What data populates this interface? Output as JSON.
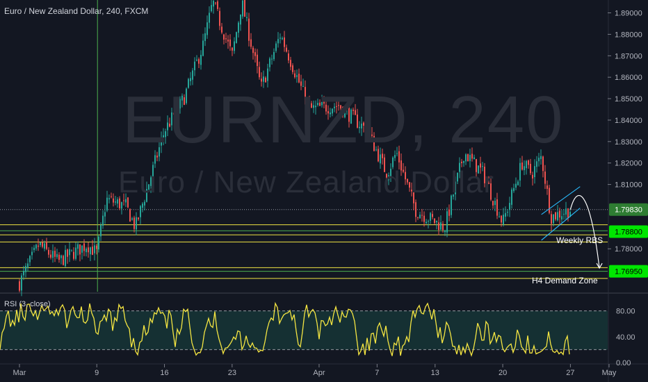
{
  "header": {
    "title": "Euro / New Zealand Dollar, 240, FXCM",
    "rsi_label": "RSI (3, close)"
  },
  "watermark": {
    "symbol": "EURNZD, 240",
    "name": "Euro / New Zealand Dollar"
  },
  "annotations": {
    "weekly_rbs": "Weekly RBS",
    "h4_demand": "H4 Demand Zone"
  },
  "colors": {
    "background": "#131722",
    "up_candle": "#26a69a",
    "down_candle": "#ef5350",
    "support_line": "#f0e442",
    "green_line": "#4caf50",
    "channel": "#29b6f6",
    "rsi_line": "#f5e642",
    "rsi_fill": "#153033",
    "price_tag": "#00e600"
  },
  "chart_data": [
    {
      "type": "candlestick",
      "symbol": "EURNZD",
      "timeframe": "240",
      "source": "FXCM",
      "y_axis": {
        "range": [
          1.76,
          1.896
        ],
        "ticks": [
          "1.89000",
          "1.88000",
          "1.87000",
          "1.86000",
          "1.85000",
          "1.84000",
          "1.83000",
          "1.82000",
          "1.81000",
          "1.78000"
        ]
      },
      "x_axis": {
        "ticks": [
          "Mar",
          "9",
          "16",
          "23",
          "Apr",
          "7",
          "13",
          "20",
          "27",
          "May"
        ]
      },
      "price_tags": [
        {
          "label": "1.79830",
          "value": 1.7983,
          "style": "current"
        },
        {
          "label": "1.78800",
          "value": 1.788,
          "style": "level"
        },
        {
          "label": "1.76950",
          "value": 1.7695,
          "style": "level"
        }
      ],
      "horizontal_levels": [
        {
          "value": 1.7912,
          "color": "yellow"
        },
        {
          "value": 1.7884,
          "color": "green"
        },
        {
          "value": 1.7865,
          "color": "yellow"
        },
        {
          "value": 1.7832,
          "color": "yellow"
        },
        {
          "value": 1.7712,
          "color": "yellow"
        },
        {
          "value": 1.7695,
          "color": "green"
        },
        {
          "value": 1.7662,
          "color": "yellow"
        }
      ],
      "trend_path": [
        {
          "date": "2020-03-01",
          "value": 1.764
        },
        {
          "date": "2020-03-03",
          "value": 1.782
        },
        {
          "date": "2020-03-05",
          "value": 1.774
        },
        {
          "date": "2020-03-08",
          "value": 1.782
        },
        {
          "date": "2020-03-09",
          "value": 1.778
        },
        {
          "date": "2020-03-10",
          "value": 1.803
        },
        {
          "date": "2020-03-12",
          "value": 1.8
        },
        {
          "date": "2020-03-13",
          "value": 1.79
        },
        {
          "date": "2020-03-16",
          "value": 1.835
        },
        {
          "date": "2020-03-18",
          "value": 1.85
        },
        {
          "date": "2020-03-20",
          "value": 1.875
        },
        {
          "date": "2020-03-21",
          "value": 1.895
        },
        {
          "date": "2020-03-23",
          "value": 1.87
        },
        {
          "date": "2020-03-24",
          "value": 1.895
        },
        {
          "date": "2020-03-26",
          "value": 1.855
        },
        {
          "date": "2020-03-28",
          "value": 1.88
        },
        {
          "date": "2020-03-31",
          "value": 1.845
        },
        {
          "date": "2020-04-03",
          "value": 1.847
        },
        {
          "date": "2020-04-06",
          "value": 1.835
        },
        {
          "date": "2020-04-08",
          "value": 1.815
        },
        {
          "date": "2020-04-09",
          "value": 1.825
        },
        {
          "date": "2020-04-11",
          "value": 1.798
        },
        {
          "date": "2020-04-14",
          "value": 1.79
        },
        {
          "date": "2020-04-16",
          "value": 1.825
        },
        {
          "date": "2020-04-18",
          "value": 1.815
        },
        {
          "date": "2020-04-20",
          "value": 1.792
        },
        {
          "date": "2020-04-22",
          "value": 1.82
        },
        {
          "date": "2020-04-23",
          "value": 1.815
        },
        {
          "date": "2020-04-24",
          "value": 1.823
        },
        {
          "date": "2020-04-25",
          "value": 1.795
        },
        {
          "date": "2020-04-27",
          "value": 1.7983
        }
      ],
      "channel": {
        "upper": [
          {
            "date": "2020-04-24",
            "value": 1.796
          },
          {
            "date": "2020-04-28",
            "value": 1.809
          }
        ],
        "lower": [
          {
            "date": "2020-04-24",
            "value": 1.784
          },
          {
            "date": "2020-04-28",
            "value": 1.799
          }
        ]
      },
      "projection": [
        {
          "date": "2020-04-27",
          "value": 1.7983
        },
        {
          "date": "2020-04-28",
          "value": 1.806
        },
        {
          "date": "2020-04-29",
          "value": 1.795
        },
        {
          "date": "2020-04-30",
          "value": 1.771
        }
      ],
      "annotations": [
        "Weekly RBS",
        "H4 Demand Zone"
      ]
    },
    {
      "type": "line",
      "indicator": "RSI (3, close)",
      "y_axis": {
        "range": [
          0,
          100
        ],
        "ticks": [
          "80.00",
          "40.00",
          "0.00"
        ]
      },
      "bands": {
        "upper": 80,
        "lower": 20
      }
    }
  ]
}
